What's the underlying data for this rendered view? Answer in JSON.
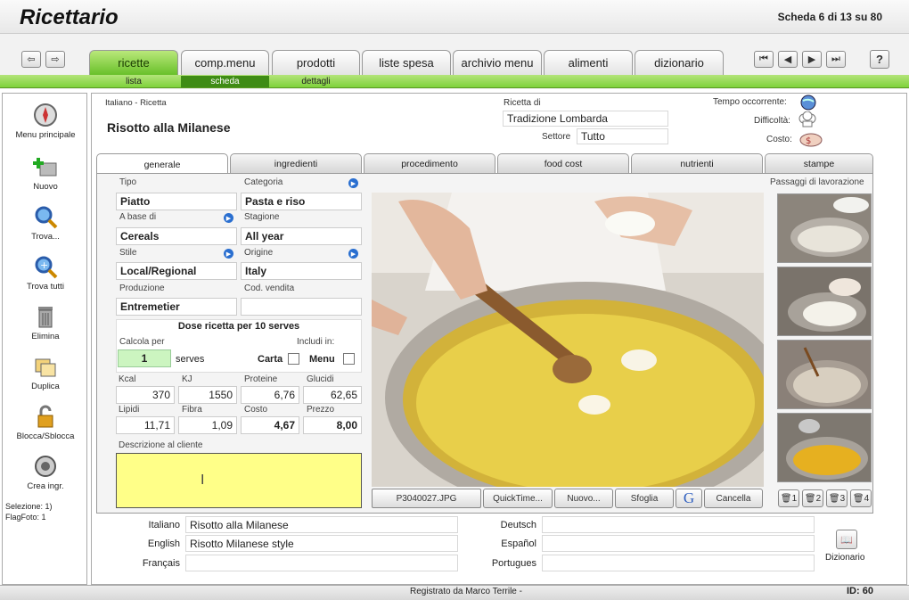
{
  "app": {
    "title": "Ricettario",
    "record_status": "Scheda 6 di 13 su 80"
  },
  "main_tabs": [
    {
      "label": "ricette"
    },
    {
      "label": "comp.menu"
    },
    {
      "label": "prodotti"
    },
    {
      "label": "liste spesa"
    },
    {
      "label": "archivio menu"
    },
    {
      "label": "alimenti"
    },
    {
      "label": "dizionario"
    }
  ],
  "sub_tabs": [
    {
      "label": "lista"
    },
    {
      "label": "scheda"
    },
    {
      "label": "dettagli"
    }
  ],
  "help_label": "?",
  "sidebar": {
    "items": [
      {
        "label": "Menu principale",
        "icon": "compass-icon"
      },
      {
        "label": "Nuovo",
        "icon": "add-icon"
      },
      {
        "label": "Trova...",
        "icon": "magnifier-icon"
      },
      {
        "label": "Trova tutti",
        "icon": "magnifier-plus-icon"
      },
      {
        "label": "Elimina",
        "icon": "trash-icon"
      },
      {
        "label": "Duplica",
        "icon": "duplicate-icon"
      },
      {
        "label": "Blocca/Sblocca",
        "icon": "lock-icon"
      },
      {
        "label": "Crea ingr.",
        "icon": "create-ingredient-icon"
      }
    ],
    "selection": "Selezione: 1)",
    "flag": "FlagFoto: 1"
  },
  "header": {
    "recipe_lang_label": "Italiano - Ricetta",
    "recipe_name": "Risotto alla Milanese",
    "ricetta_di_label": "Ricetta di",
    "ricetta_di": "Tradizione Lombarda",
    "settore_label": "Settore",
    "settore": "Tutto",
    "tempo_label": "Tempo occorrente:",
    "difficolta_label": "Difficoltà:",
    "costo_label": "Costo:"
  },
  "content_tabs": [
    {
      "label": "generale"
    },
    {
      "label": "ingredienti"
    },
    {
      "label": "procedimento"
    },
    {
      "label": "food cost"
    },
    {
      "label": "nutrienti"
    },
    {
      "label": "stampe"
    }
  ],
  "generale": {
    "tipo_label": "Tipo",
    "tipo": "Piatto",
    "categoria_label": "Categoria",
    "categoria": "Pasta e riso",
    "base_label": "A base di",
    "base": "Cereals",
    "stagione_label": "Stagione",
    "stagione": "All year",
    "stile_label": "Stile",
    "stile": "Local/Regional",
    "origine_label": "Origine",
    "origine": "Italy",
    "produzione_label": "Produzione",
    "produzione": "Entremetier",
    "codvendita_label": "Cod. vendita",
    "codvendita": "",
    "dose_title": "Dose ricetta per 10 serves",
    "calcola_label": "Calcola per",
    "calcola": "1",
    "serves_label": "serves",
    "includi_label": "Includi in:",
    "carta_label": "Carta",
    "menu_label": "Menu",
    "kcal_label": "Kcal",
    "kcal": "370",
    "kj_label": "KJ",
    "kj": "1550",
    "proteine_label": "Proteine",
    "proteine": "6,76",
    "glucidi_label": "Glucidi",
    "glucidi": "62,65",
    "lipidi_label": "Lipidi",
    "lipidi": "11,71",
    "fibra_label": "Fibra",
    "fibra": "1,09",
    "costo_label": "Costo",
    "costo": "4,67",
    "prezzo_label": "Prezzo",
    "prezzo": "8,00",
    "descrizione_label": "Descrizione al cliente",
    "descrizione": "",
    "passaggi_label": "Passaggi di lavorazione"
  },
  "photo_buttons": [
    {
      "label": "P3040027.JPG"
    },
    {
      "label": "QuickTime..."
    },
    {
      "label": "Nuovo..."
    },
    {
      "label": "Sfoglia"
    },
    {
      "label": "G"
    },
    {
      "label": "Cancella"
    }
  ],
  "thumb_buttons": [
    {
      "label": "1"
    },
    {
      "label": "2"
    },
    {
      "label": "3"
    },
    {
      "label": "4"
    }
  ],
  "translations": {
    "italiano_label": "Italiano",
    "italiano": "Risotto alla Milanese",
    "english_label": "English",
    "english": "Risotto Milanese style",
    "francais_label": "Français",
    "francais": "",
    "deutsch_label": "Deutsch",
    "deutsch": "",
    "espanol_label": "Español",
    "espanol": "",
    "portugues_label": "Portugues",
    "portugues": "",
    "dizionario_label": "Dizionario"
  },
  "footer": {
    "registered": "Registrato da Marco Terrile -",
    "id": "ID: 60"
  },
  "colors": {
    "accent_green": "#68c02a",
    "description_yellow": "#ffff88",
    "calc_green": "#ccf5c0"
  }
}
